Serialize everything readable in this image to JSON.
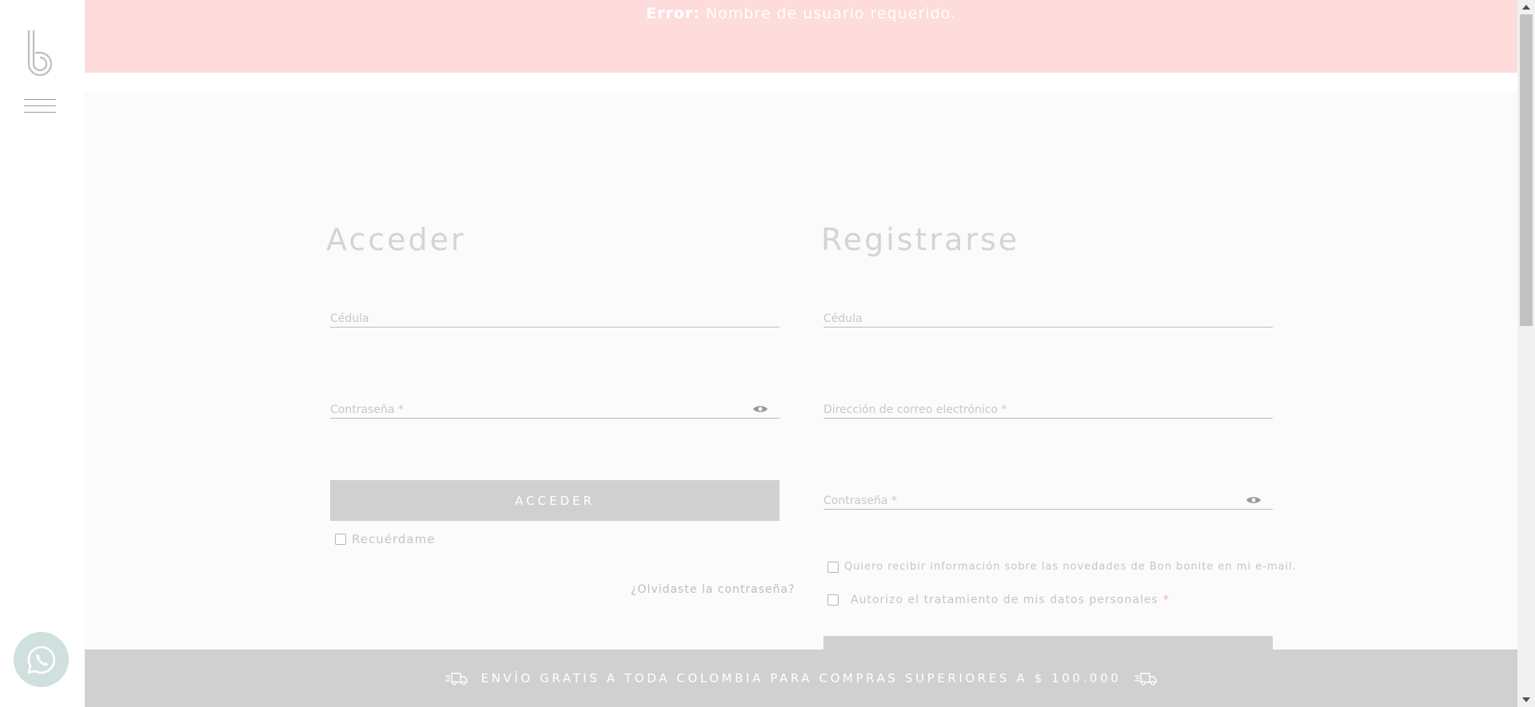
{
  "error": {
    "label": "Error:",
    "message": "Nombre de usuario requerido."
  },
  "login": {
    "heading": "Acceder",
    "id_placeholder": "Cédula",
    "password_placeholder": "Contraseña *",
    "submit_label": "ACCEDER",
    "remember_label": "Recuérdame",
    "forgot_label": "¿Olvidaste la contraseña?"
  },
  "register": {
    "heading": "Registrarse",
    "id_placeholder": "Cédula",
    "email_placeholder": "Dirección de correo electrónico *",
    "password_placeholder": "Contraseña *",
    "newsletter_label": "Quiero recibir información sobre las novedades de Bon bonite en mi e-mail.",
    "privacy_label": "Autorizo el tratamiento de mis datos personales",
    "required_mark": "*"
  },
  "shipping": {
    "text": "ENVÍO GRATIS A TODA COLOMBIA PARA COMPRAS SUPERIORES A $ 100.000"
  },
  "icons": {
    "logo": "bon-bonite-logo",
    "menu": "hamburger-menu-icon",
    "whatsapp": "whatsapp-icon",
    "eye": "eye-icon",
    "truck": "truck-icon"
  },
  "colors": {
    "error_bg": "#fddcdb",
    "button_bg": "#d0d0d0",
    "content_bg": "#fbfbfb",
    "whatsapp_bg": "#cfe0df",
    "required": "#f2aeb0"
  }
}
